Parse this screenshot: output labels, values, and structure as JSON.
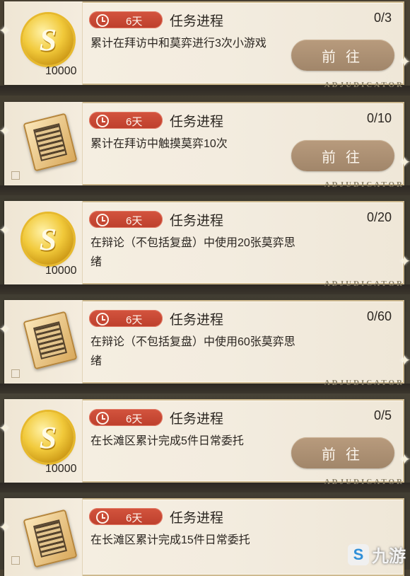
{
  "task_list": [
    {
      "reward_type": "coin",
      "reward_icon": "s-coin-icon",
      "reward_amount": "10000",
      "days": "6天",
      "progress_label": "任务进程",
      "progress": "0/3",
      "description": "累计在拜访中和莫弈进行3次小游戏",
      "button": "前往",
      "tag": "ADJUDICATOR"
    },
    {
      "reward_type": "item",
      "reward_icon": "card-book-icon",
      "reward_amount": "",
      "days": "6天",
      "progress_label": "任务进程",
      "progress": "0/10",
      "description": "累计在拜访中触摸莫弈10次",
      "button": "前往",
      "tag": "ADJUDICATOR"
    },
    {
      "reward_type": "coin",
      "reward_icon": "s-coin-icon",
      "reward_amount": "10000",
      "days": "6天",
      "progress_label": "任务进程",
      "progress": "0/20",
      "description": "在辩论（不包括复盘）中使用20张莫弈思绪",
      "button": "",
      "tag": "ADJUDICATOR"
    },
    {
      "reward_type": "item",
      "reward_icon": "card-book-icon",
      "reward_amount": "",
      "days": "6天",
      "progress_label": "任务进程",
      "progress": "0/60",
      "description": "在辩论（不包括复盘）中使用60张莫弈思绪",
      "button": "",
      "tag": "ADJUDICATOR"
    },
    {
      "reward_type": "coin",
      "reward_icon": "s-coin-icon",
      "reward_amount": "10000",
      "days": "6天",
      "progress_label": "任务进程",
      "progress": "0/5",
      "description": "在长滩区累计完成5件日常委托",
      "button": "前往",
      "tag": "ADJUDICATOR"
    },
    {
      "reward_type": "item",
      "reward_icon": "card-book-icon",
      "reward_amount": "",
      "days": "6天",
      "progress_label": "任务进程",
      "progress": "",
      "description": "在长滩区累计完成15件日常委托",
      "button": "",
      "tag": ""
    }
  ],
  "coin_symbol": "S",
  "watermark": {
    "logo": "S",
    "text": "九游"
  }
}
